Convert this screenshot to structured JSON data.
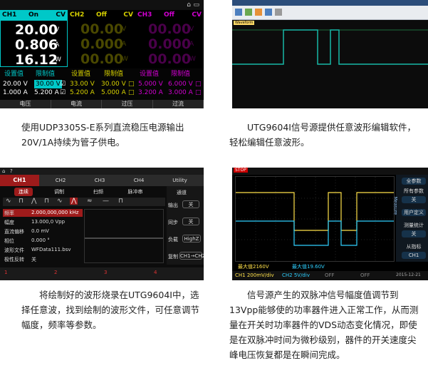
{
  "psu": {
    "ch1": {
      "name": "CH1",
      "state": "On",
      "mode": "CV",
      "voltage": "20.00",
      "v_unit": "V",
      "current": "0.806",
      "a_unit": "A",
      "power": "16.12",
      "w_unit": "W",
      "set_label": "设置值",
      "limit_label": "限制值",
      "set_v": "20.00 V",
      "set_a": "1.000 A",
      "lim_v": "30.00 V",
      "lim_a": "5.200 A"
    },
    "ch2": {
      "name": "CH2",
      "state": "Off",
      "mode": "CV",
      "voltage": "00.00",
      "v_unit": "V",
      "current": "0.000",
      "a_unit": "A",
      "power": "00.00",
      "w_unit": "W",
      "set_label": "设置值",
      "limit_label": "限制值",
      "set_v": "33.00 V",
      "set_a": "5.200 A",
      "lim_v": "30.00 V",
      "lim_a": "5.000 A"
    },
    "ch3": {
      "name": "CH3",
      "state": "Off",
      "mode": "CV",
      "voltage": "00.00",
      "v_unit": "V",
      "current": "0.000",
      "a_unit": "A",
      "power": "00.00",
      "w_unit": "W",
      "set_label": "设置值",
      "limit_label": "限制值",
      "set_v": "5.000 V",
      "set_a": "3.200 A",
      "lim_v": "6.000 V",
      "lim_a": "3.000 A"
    },
    "nav": [
      "电压",
      "电流",
      "过压",
      "过流"
    ],
    "colors": {
      "ch1": "#00c8c8",
      "ch2": "#d6d000",
      "ch3": "#d000d0"
    }
  },
  "sw": {
    "tab": "Waveform"
  },
  "gen": {
    "tabs": [
      "CH1",
      "CH2",
      "CH3",
      "CH4",
      "Utility"
    ],
    "menu": [
      "连续",
      "调制",
      "扫频",
      "脉冲串"
    ],
    "side_title": "通道",
    "side": [
      {
        "label": "输出",
        "value": "关"
      },
      {
        "label": "同步",
        "value": "关"
      },
      {
        "label": "负载",
        "value": "HighZ"
      },
      {
        "label": "复制",
        "value": "CH1→CH2"
      }
    ],
    "params": [
      {
        "label": "频率",
        "value": "2.000,000,000 kHz"
      },
      {
        "label": "幅度",
        "value": "13.000,0 Vpp"
      },
      {
        "label": "直流偏移",
        "value": "0.0 mV"
      },
      {
        "label": "相位",
        "value": "0.000 °"
      },
      {
        "label": "波形文件",
        "value": "WFData111.bsv"
      },
      {
        "label": "极性反转",
        "value": "关"
      }
    ],
    "bottom": [
      "1",
      "2",
      "3",
      "4"
    ]
  },
  "scope": {
    "top_left": "STOP",
    "menu_title": "Measure",
    "menu": [
      "全参数",
      "所有参数",
      "关",
      "用户定义",
      "测量统计",
      "关",
      "从指标",
      "CH1"
    ],
    "status": [
      "最大值2160V",
      "最大值19.60V"
    ],
    "bottom": [
      "CH1 200mV/div",
      "CH2 5V/div",
      "OFF",
      "OFF"
    ],
    "datetime": "2015-12-21"
  },
  "captions": {
    "c1": "使用UDP3305S-E系列直流稳压电源输出20V/1A持续为管子供电。",
    "c2": "UTG9604I信号源提供任意波形编辑软件，轻松编辑任意波形。",
    "c3": "将绘制好的波形烧录在UTG9604I中，选择任意波，找到绘制的波形文件，可任意调节幅度，频率等参数。",
    "c4": "信号源产生的双脉冲信号幅度值调节到13Vpp能够使的功率器件进入正常工作，从而测量在开关时功率器件的VDS动态变化情况，即使是在双脉冲时间为微秒级别，器件的开关速度尖峰电压恢复都是在瞬间完成。"
  }
}
